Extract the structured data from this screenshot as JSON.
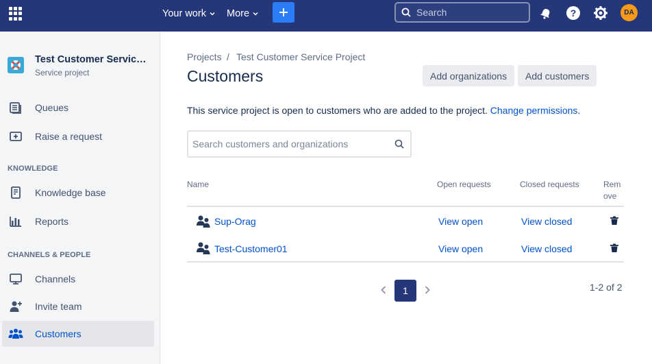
{
  "topnav": {
    "your_work": "Your work",
    "more": "More",
    "search_placeholder": "Search",
    "avatar_initials": "DA",
    "bg_color": "#253778",
    "create_color": "#2a7cf7",
    "avatar_color": "#f79a1a"
  },
  "sidebar": {
    "project_name": "Test Customer Service Project",
    "project_type": "Service project",
    "items_top": [
      {
        "label": "Queues",
        "icon": "queues-icon"
      },
      {
        "label": "Raise a request",
        "icon": "raise-request-icon"
      }
    ],
    "knowledge_heading": "KNOWLEDGE",
    "items_knowledge": [
      {
        "label": "Knowledge base",
        "icon": "knowledge-base-icon"
      },
      {
        "label": "Reports",
        "icon": "reports-icon"
      }
    ],
    "channels_heading": "CHANNELS & PEOPLE",
    "items_channels": [
      {
        "label": "Channels",
        "icon": "monitor-icon"
      },
      {
        "label": "Invite team",
        "icon": "invite-team-icon"
      },
      {
        "label": "Customers",
        "icon": "customers-icon",
        "active": true
      }
    ]
  },
  "breadcrumb": {
    "root": "Projects",
    "separator": "/",
    "project": "Test Customer Service Project"
  },
  "page": {
    "title": "Customers",
    "add_organizations": "Add organizations",
    "add_customers": "Add customers",
    "info_text": "This service project is open to customers who are added to the project. ",
    "info_link": "Change permissions",
    "info_end": ".",
    "search_placeholder": "Search customers and organizations"
  },
  "table": {
    "headers": {
      "name": "Name",
      "open": "Open requests",
      "closed": "Closed requests",
      "remove_1": "Rem",
      "remove_2": "ove"
    },
    "rows": [
      {
        "name": "Sup-Orag",
        "open": "View open",
        "closed": "View closed"
      },
      {
        "name": "Test-Customer01",
        "open": "View open",
        "closed": "View closed"
      }
    ]
  },
  "pagination": {
    "current": "1",
    "count": "1-2 of 2"
  }
}
